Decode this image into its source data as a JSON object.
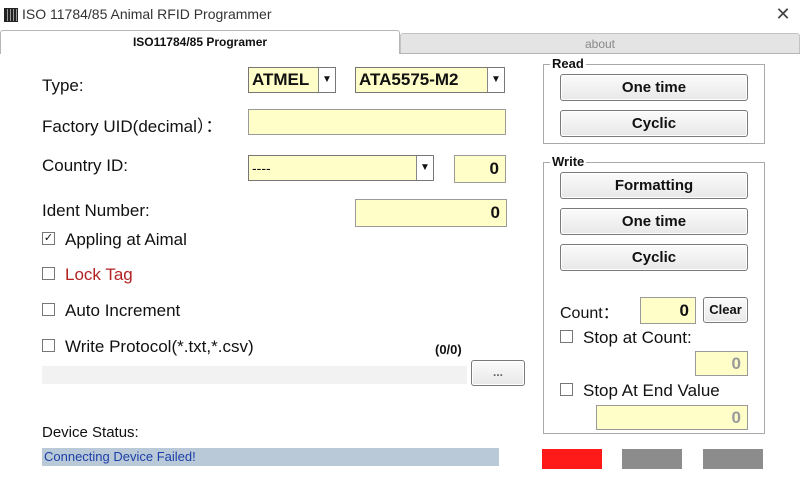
{
  "window": {
    "title": "ISO 11784/85 Animal RFID Programmer",
    "close_symbol": "✕"
  },
  "tabs": [
    {
      "label": "ISO11784/85 Programer",
      "active": true
    },
    {
      "label": "about",
      "active": false
    }
  ],
  "form": {
    "type_label": "Type:",
    "type_manufacturer": "ATMEL",
    "type_chip": "ATA5575-M2",
    "factory_uid_label": "Factory UID(decimal）：",
    "factory_uid_value": "",
    "country_id_label": "Country ID:",
    "country_id_select": "----",
    "country_id_value": "0",
    "ident_number_label": "Ident Number:",
    "ident_number_value": "0",
    "dropdown_arrow": "▼"
  },
  "options": {
    "appling_at_animal": {
      "label": "Appling at Aimal",
      "checked": true
    },
    "lock_tag": {
      "label": "Lock Tag",
      "checked": false,
      "color": "#b22222"
    },
    "auto_increment": {
      "label": "Auto Increment",
      "checked": false
    },
    "write_protocol": {
      "label": "Write Protocol(*.txt,*.csv)",
      "checked": false
    },
    "check_mark": "✓"
  },
  "protocol": {
    "counter": "(0/0)",
    "browse_label": "..."
  },
  "read_group": {
    "title": "Read",
    "one_time_label": "One time",
    "cyclic_label": "Cyclic"
  },
  "write_group": {
    "title": "Write",
    "formatting_label": "Formatting",
    "one_time_label": "One time",
    "cyclic_label": "Cyclic",
    "count_label": "Count：",
    "count_value": "0",
    "clear_label": "Clear",
    "stop_at_count_label": "Stop at Count:",
    "stop_at_count_value": "0",
    "stop_at_end_label": "Stop At End Value",
    "stop_at_end_value": "0"
  },
  "device": {
    "status_label": "Device Status:",
    "status_message": "Connecting Device Failed!",
    "indicator_colors": [
      "#ff1a1a",
      "#8c8c8c",
      "#8c8c8c"
    ]
  }
}
